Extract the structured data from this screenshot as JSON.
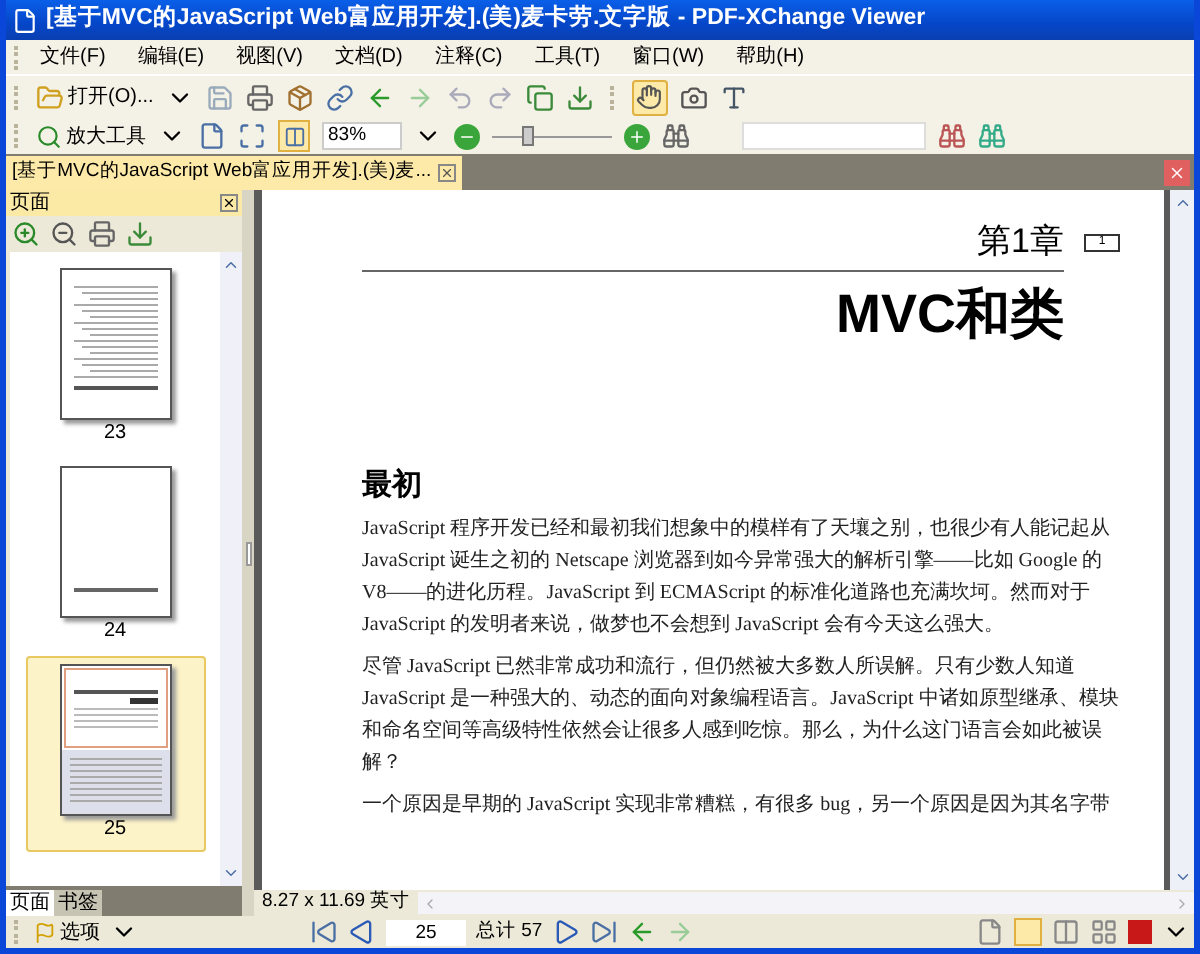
{
  "window": {
    "title": "[基于MVC的JavaScript Web富应用开发].(美)麦卡劳.文字版 - PDF-XChange Viewer"
  },
  "menu": [
    "文件(F)",
    "编辑(E)",
    "视图(V)",
    "文档(D)",
    "注释(C)",
    "工具(T)",
    "窗口(W)",
    "帮助(H)"
  ],
  "toolbar": {
    "open_label": "打开(O)...",
    "zoom_tool_label": "放大工具",
    "zoom_value": "83%",
    "zoom_slider": {
      "level": 0.3
    }
  },
  "tabs": [
    {
      "label": "[基于MVC的JavaScript Web富应用开发].(美)麦...",
      "selected": true
    }
  ],
  "pages_panel": {
    "title": "页面",
    "thumbnails": [
      {
        "label": "23",
        "kind": "contents",
        "selected": false
      },
      {
        "label": "24",
        "kind": "blank",
        "selected": false
      },
      {
        "label": "25",
        "kind": "chapter",
        "selected": true
      }
    ],
    "tabs": [
      {
        "label": "页面",
        "selected": true
      },
      {
        "label": "书签",
        "selected": false
      }
    ]
  },
  "document": {
    "chapter": "第1章",
    "chapter_tag": "1",
    "title": "MVC和类",
    "heading": "最初",
    "paragraphs": [
      "JavaScript 程序开发已经和最初我们想象中的模样有了天壤之别，也很少有人能记起从 JavaScript 诞生之初的 Netscape 浏览器到如今异常强大的解析引擎——比如 Google 的 V8——的进化历程。JavaScript 到 ECMAScript 的标准化道路也充满坎坷。然而对于 JavaScript 的发明者来说，做梦也不会想到 JavaScript 会有今天这么强大。",
      "尽管 JavaScript 已然非常成功和流行，但仍然被大多数人所误解。只有少数人知道 JavaScript 是一种强大的、动态的面向对象编程语言。JavaScript 中诸如原型继承、模块和命名空间等高级特性依然会让很多人感到吃惊。那么，为什么这门语言会如此被误解？",
      "一个原因是早期的 JavaScript 实现非常糟糕，有很多 bug，另一个原因是因为其名字带"
    ]
  },
  "status": {
    "page_size": "8.27 x 11.69 英寸",
    "options": "选项",
    "page_number": "25",
    "total": "总计 57"
  }
}
